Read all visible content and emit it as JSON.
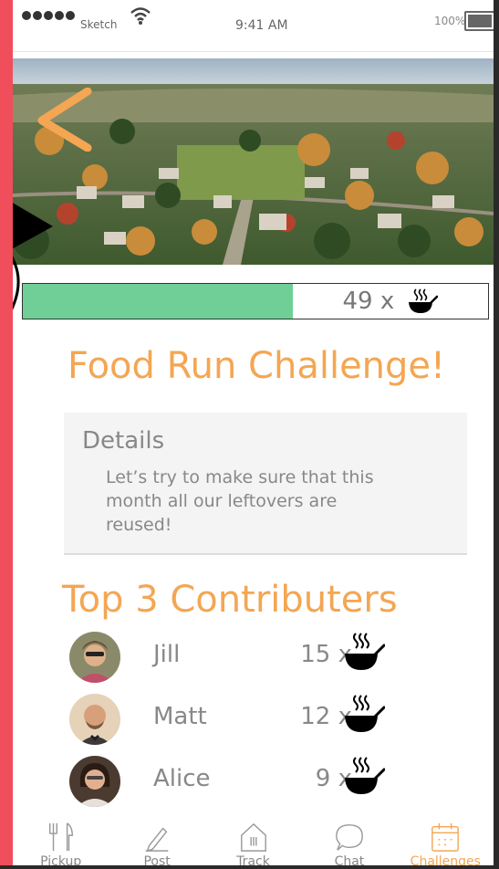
{
  "status_bar": {
    "carrier": "Sketch",
    "time": "9:41 AM",
    "battery": "100%"
  },
  "progress": {
    "fraction": 0.58,
    "count": "49 x",
    "icon": "cooking-pot-icon"
  },
  "challenge": {
    "title": "Food Run Challenge!"
  },
  "details": {
    "heading": "Details",
    "body": "Let’s try to make sure that this month all our leftovers are reused!"
  },
  "contributors": {
    "heading": "Top 3 Contributers",
    "items": [
      {
        "name": "Jill",
        "count": "15 x"
      },
      {
        "name": "Matt",
        "count": "12 x"
      },
      {
        "name": "Alice",
        "count": "9 x"
      }
    ]
  },
  "tabs": [
    {
      "label": "Pickup",
      "icon": "utensils-icon"
    },
    {
      "label": "Post",
      "icon": "pencil-icon"
    },
    {
      "label": "Track",
      "icon": "home-icon"
    },
    {
      "label": "Chat",
      "icon": "chat-bubble-icon"
    },
    {
      "label": "Challenges",
      "icon": "calendar-icon"
    }
  ],
  "colors": {
    "accent": "#f4a653",
    "progress": "#6fcf97",
    "frame": "#f04e5a"
  }
}
